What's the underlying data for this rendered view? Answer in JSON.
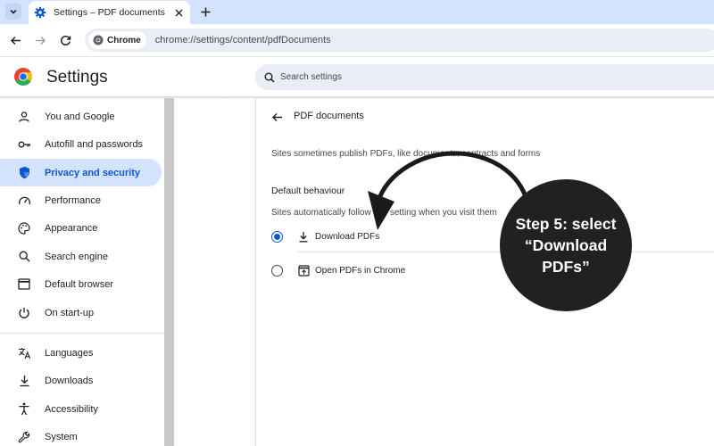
{
  "browser": {
    "tab_title": "Settings – PDF documents",
    "chip_label": "Chrome",
    "url": "chrome://settings/content/pdfDocuments"
  },
  "settings": {
    "title": "Settings",
    "search_placeholder": "Search settings"
  },
  "sidebar": {
    "items": [
      {
        "label": "You and Google",
        "icon": "person-icon"
      },
      {
        "label": "Autofill and passwords",
        "icon": "key-icon"
      },
      {
        "label": "Privacy and security",
        "icon": "shield-icon",
        "active": true
      },
      {
        "label": "Performance",
        "icon": "gauge-icon"
      },
      {
        "label": "Appearance",
        "icon": "palette-icon"
      },
      {
        "label": "Search engine",
        "icon": "search-icon"
      },
      {
        "label": "Default browser",
        "icon": "browser-window-icon"
      },
      {
        "label": "On start-up",
        "icon": "power-icon"
      },
      {
        "label": "Languages",
        "icon": "translate-icon"
      },
      {
        "label": "Downloads",
        "icon": "download-icon"
      },
      {
        "label": "Accessibility",
        "icon": "accessibility-icon"
      },
      {
        "label": "System",
        "icon": "wrench-icon"
      }
    ]
  },
  "main": {
    "page_title": "PDF documents",
    "description": "Sites sometimes publish PDFs, like documents, contracts and forms",
    "section_title": "Default behaviour",
    "section_description": "Sites automatically follow this setting when you visit them",
    "options": [
      {
        "label": "Download PDFs",
        "icon": "download-icon",
        "selected": true
      },
      {
        "label": "Open PDFs in Chrome",
        "icon": "open-in-new-icon",
        "selected": false
      }
    ]
  },
  "annotation": {
    "text": "Step 5: select\n“Download\nPDFs”"
  },
  "colors": {
    "accent": "#0b57d0",
    "active_nav_bg": "#d3e3fd",
    "annotation_bg": "#212121"
  }
}
